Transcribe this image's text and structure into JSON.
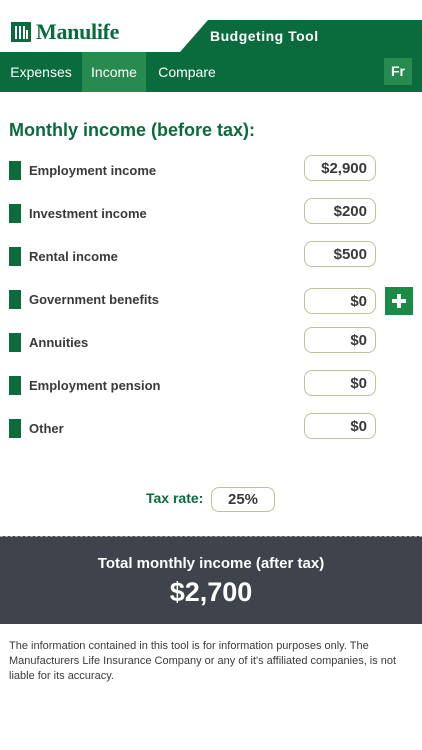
{
  "header": {
    "brand": "Manulife",
    "title": "Budgeting Tool"
  },
  "nav": {
    "tabs": [
      {
        "label": "Expenses",
        "active": false
      },
      {
        "label": "Income",
        "active": true
      },
      {
        "label": "Compare",
        "active": false
      }
    ],
    "language_button": "Fr"
  },
  "income": {
    "section_title": "Monthly income (before tax):",
    "rows": [
      {
        "label": "Employment income",
        "value": "$2,900"
      },
      {
        "label": "Investment income",
        "value": "$200"
      },
      {
        "label": "Rental income",
        "value": "$500"
      },
      {
        "label": "Government benefits",
        "value": "$0"
      },
      {
        "label": "Annuities",
        "value": "$0"
      },
      {
        "label": "Employment pension",
        "value": "$0"
      },
      {
        "label": "Other",
        "value": "$0"
      }
    ],
    "tax_label": "Tax rate:",
    "tax_value": "25%"
  },
  "total": {
    "label": "Total monthly income (after tax)",
    "value": "$2,700"
  },
  "disclaimer": "The information contained in this tool is for information purposes only. The Manufacturers Life Insurance Company or any of it's affiliated companies, is not liable for its accuracy.",
  "colors": {
    "brand_green": "#0a6b3d",
    "active_tab_green": "#278a4f",
    "add_button_green": "#1a8a47",
    "total_band": "#3f444c",
    "input_border": "#b8c39a"
  }
}
